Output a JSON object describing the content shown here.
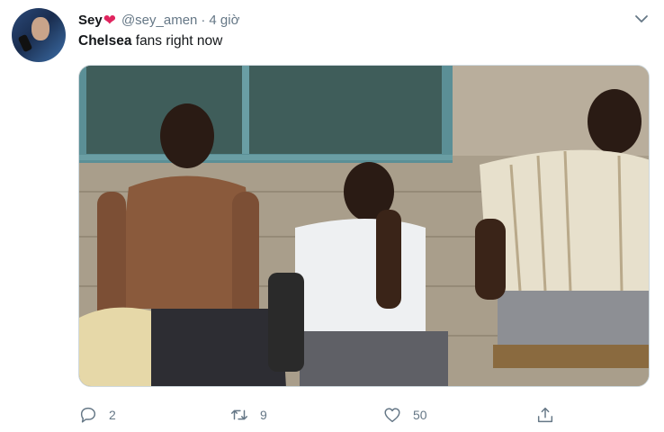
{
  "tweet": {
    "display_name": "Sey",
    "name_emoji": "❤",
    "handle": "@sey_amen",
    "separator": "·",
    "time": "4 giờ",
    "text_bold": "Chelsea",
    "text_rest": " fans right now",
    "media_subject": "three men sitting against a wall looking dejected"
  },
  "actions": {
    "reply_count": "2",
    "retweet_count": "9",
    "like_count": "50"
  },
  "icons": {
    "reply": "reply-icon",
    "retweet": "retweet-icon",
    "like": "like-icon",
    "share": "share-icon",
    "menu": "chevron-down-icon"
  },
  "colors": {
    "text": "#14171a",
    "secondary": "#657786",
    "heart": "#e0245e"
  }
}
